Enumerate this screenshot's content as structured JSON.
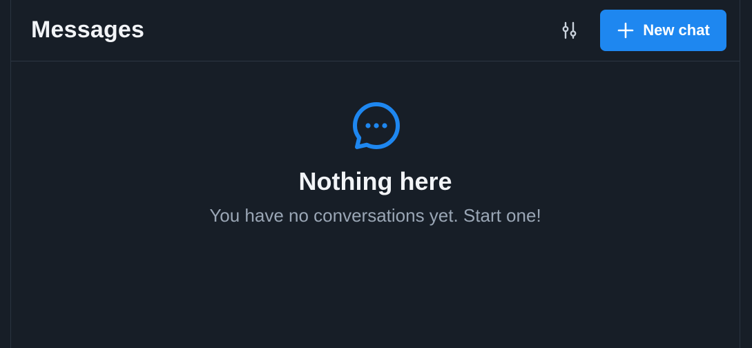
{
  "header": {
    "title": "Messages",
    "filter_icon": "sliders-icon",
    "new_chat_label": "New chat",
    "new_chat_icon": "plus-icon"
  },
  "empty_state": {
    "icon": "chat-bubble-dots-icon",
    "title": "Nothing here",
    "subtitle": "You have no conversations yet. Start one!"
  },
  "colors": {
    "background": "#171e27",
    "accent": "#1e87f0",
    "text_primary": "#f2f4f7",
    "text_secondary": "#9aa6b5",
    "divider": "#2d3743"
  }
}
